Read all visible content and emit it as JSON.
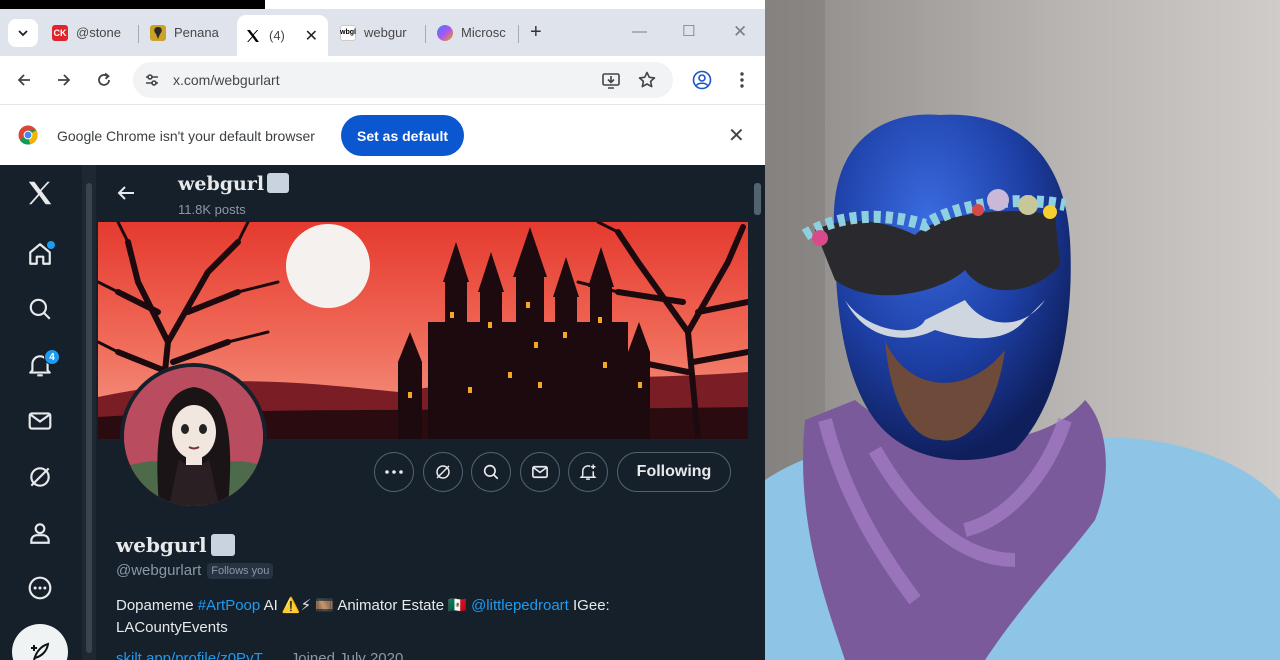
{
  "browser": {
    "tabs": [
      {
        "label": "@stone",
        "favicon_color": "#e0242d",
        "favicon_text": "CK"
      },
      {
        "label": "Penana",
        "favicon_color": "#c9a227",
        "favicon_text": ""
      },
      {
        "label": "(4)",
        "favicon_color": "#000000",
        "favicon_text": "X"
      },
      {
        "label": "webgur",
        "favicon_color": "#ffffff",
        "favicon_text": "wbgl"
      },
      {
        "label": "Microsc",
        "favicon_color": "#6b6bff",
        "favicon_text": ""
      }
    ],
    "new_tab": "+",
    "url": "x.com/webgurlart",
    "infobar": {
      "message": "Google Chrome isn't your default browser",
      "button": "Set as default"
    }
  },
  "x": {
    "nav": {
      "notifications_badge": "4"
    },
    "header": {
      "name": "webgurl",
      "posts": "11.8K posts"
    },
    "actions": {
      "follow": "Following"
    },
    "profile": {
      "name": "webgurl",
      "handle": "@webgurlart",
      "follows_you": "Follows you",
      "bio_1": "Dopameme ",
      "bio_link_1": "#ArtPoop",
      "bio_2": " AI ⚠️⚡ 🎞️ Animator Estate 🇲🇽 ",
      "bio_link_2": "@littlepedroart",
      "bio_3": " IGee:",
      "bio_4": "LACountyEvents",
      "website": "skilt.app/profile/z0PvT",
      "joined": "Joined July 2020"
    }
  },
  "colors": {
    "x_bg": "#15202b",
    "accent": "#1d9bf0",
    "chrome_blue": "#0b57d0"
  }
}
